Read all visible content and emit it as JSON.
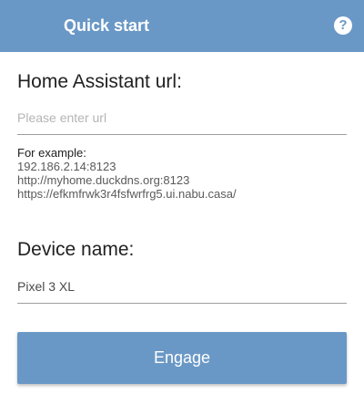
{
  "appbar": {
    "title": "Quick start",
    "help_icon": "help-circle-icon",
    "help_glyph": "?"
  },
  "url_section": {
    "label": "Home Assistant url:",
    "value": "",
    "placeholder": "Please enter url"
  },
  "examples": {
    "heading": "For example:",
    "lines": [
      "192.186.2.14:8123",
      "http://myhome.duckdns.org:8123",
      "https://efkmfrwk3r4fsfwrfrg5.ui.nabu.casa/"
    ]
  },
  "device_section": {
    "label": "Device name:",
    "value": "Pixel 3 XL"
  },
  "engage_button": {
    "label": "Engage"
  },
  "colors": {
    "accent": "#6a98c6",
    "text": "#212121",
    "placeholder": "#b4b4b4"
  }
}
